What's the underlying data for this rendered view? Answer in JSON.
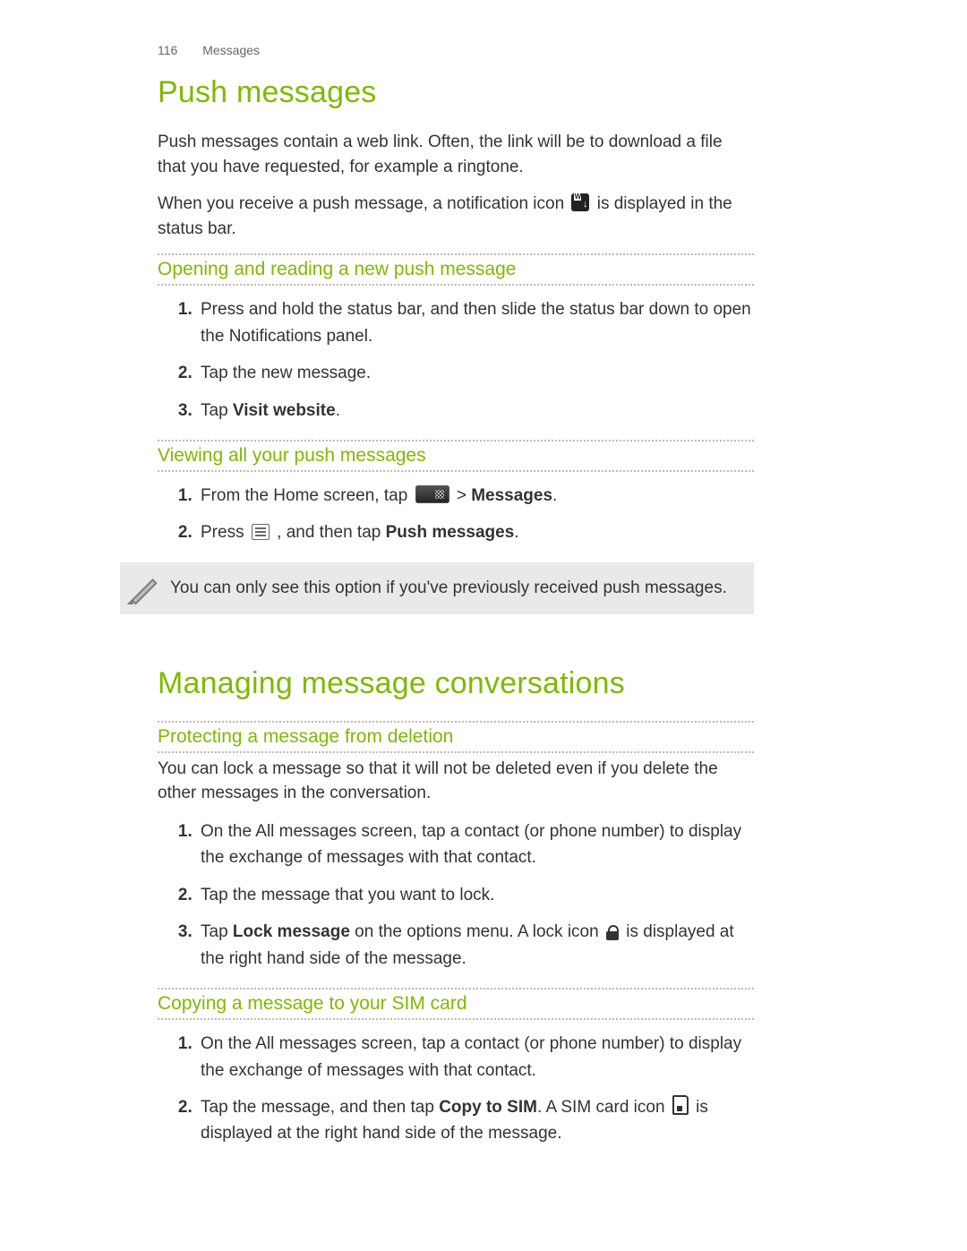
{
  "header": {
    "page_number": "116",
    "section": "Messages"
  },
  "h1a": "Push messages",
  "p1": "Push messages contain a web link. Often, the link will be to download a file that you have requested, for example a ringtone.",
  "p2a": "When you receive a push message, a notification icon ",
  "p2b": " is displayed in the status bar.",
  "h2a": "Opening and reading a new push message",
  "list_a": {
    "i1": "Press and hold the status bar, and then slide the status bar down to open the Notifications panel.",
    "i2": "Tap the new message.",
    "i3a": "Tap ",
    "i3b": "Visit website",
    "i3c": "."
  },
  "h2b": "Viewing all your push messages",
  "list_b": {
    "i1a": "From the Home screen, tap ",
    "i1b": " > ",
    "i1c": "Messages",
    "i1d": ".",
    "i2a": "Press ",
    "i2b": " , and then tap ",
    "i2c": "Push messages",
    "i2d": "."
  },
  "note": "You can only see this option if you've previously received push messages.",
  "h1b": "Managing message conversations",
  "h2c": "Protecting a message from deletion",
  "p3": "You can lock a message so that it will not be deleted even if you delete the other messages in the conversation.",
  "list_c": {
    "i1": "On the All messages screen, tap a contact (or phone number) to display the exchange of messages with that contact.",
    "i2": "Tap the message that you want to lock.",
    "i3a": "Tap ",
    "i3b": "Lock message",
    "i3c": " on the options menu. A lock icon ",
    "i3d": " is displayed at the right hand side of the message."
  },
  "h2d": "Copying a message to your SIM card",
  "list_d": {
    "i1": "On the All messages screen, tap a contact (or phone number) to display the exchange of messages with that contact.",
    "i2a": "Tap the message, and then tap ",
    "i2b": "Copy to SIM",
    "i2c": ". A SIM card icon ",
    "i2d": " is displayed at the right hand side of the message."
  }
}
